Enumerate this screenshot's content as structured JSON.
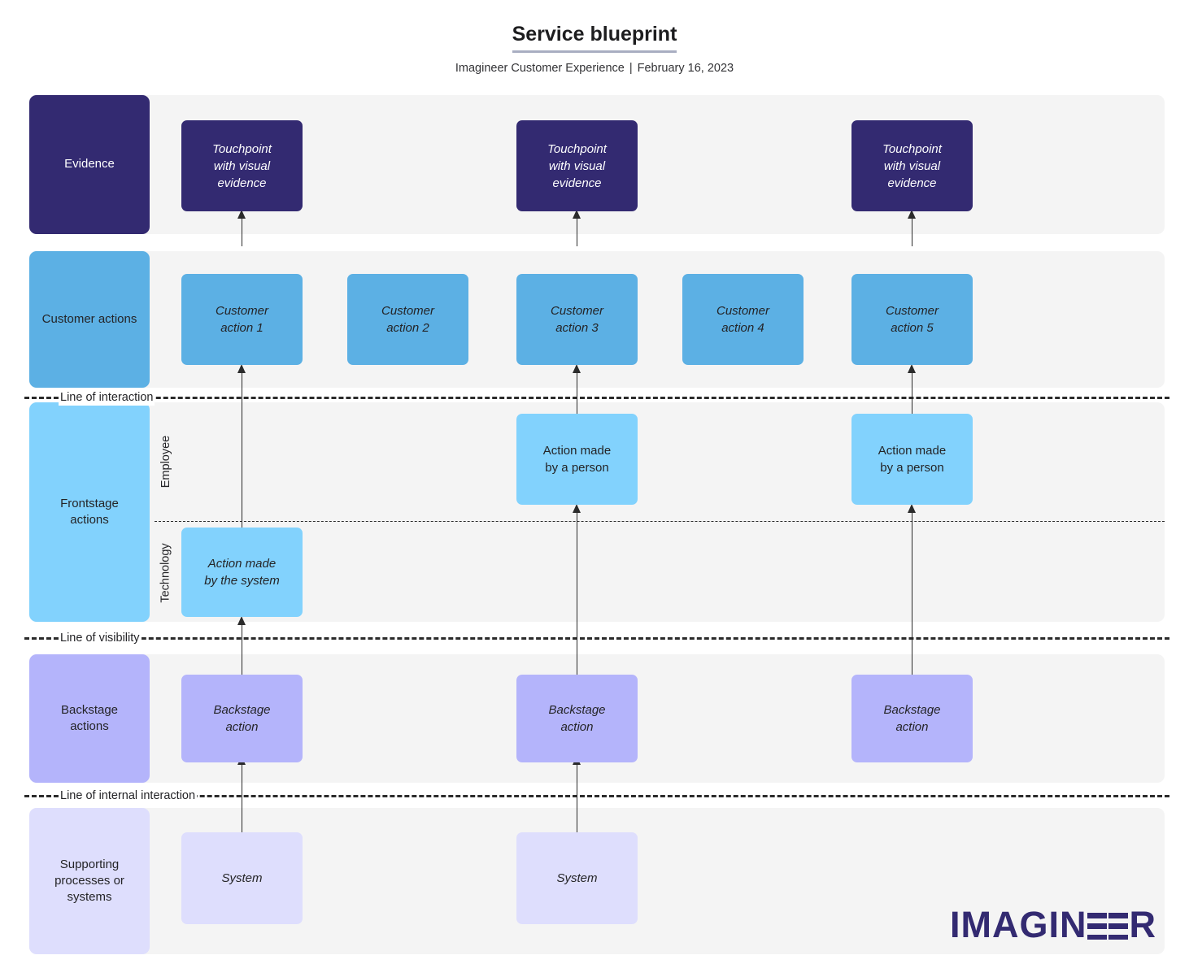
{
  "header": {
    "title": "Service blueprint",
    "org": "Imagineer Customer Experience",
    "separator": "|",
    "date": "February 16, 2023"
  },
  "rows": {
    "evidence": "Evidence",
    "customer_actions": "Customer actions",
    "frontstage_actions": "Frontstage\nactions",
    "frontstage_actions_line1": "Frontstage",
    "frontstage_actions_line2": "actions",
    "backstage_actions_line1": "Backstage",
    "backstage_actions_line2": "actions",
    "support_line1": "Supporting",
    "support_line2": "processes or",
    "support_line3": "systems"
  },
  "sublanes": {
    "employee": "Employee",
    "technology": "Technology"
  },
  "separators": {
    "interaction": "Line of interaction",
    "visibility": "Line of visibility",
    "internal_interaction": "Line of internal interaction"
  },
  "cards": {
    "evidence": [
      {
        "line1": "Touchpoint",
        "line2": "with visual",
        "line3": "evidence",
        "column": 1
      },
      {
        "line1": "Touchpoint",
        "line2": "with visual",
        "line3": "evidence",
        "column": 3
      },
      {
        "line1": "Touchpoint",
        "line2": "with visual",
        "line3": "evidence",
        "column": 5
      }
    ],
    "customer_actions": [
      {
        "line1": "Customer",
        "line2": "action 1",
        "column": 1
      },
      {
        "line1": "Customer",
        "line2": "action 2",
        "column": 2
      },
      {
        "line1": "Customer",
        "line2": "action 3",
        "column": 3
      },
      {
        "line1": "Customer",
        "line2": "action 4",
        "column": 4
      },
      {
        "line1": "Customer",
        "line2": "action 5",
        "column": 5
      }
    ],
    "frontstage_employee": [
      {
        "line1": "Action made",
        "line2": "by a person",
        "column": 3
      },
      {
        "line1": "Action made",
        "line2": "by a person",
        "column": 5
      }
    ],
    "frontstage_technology": [
      {
        "line1": "Action made",
        "line2": "by the system",
        "column": 1
      }
    ],
    "backstage": [
      {
        "line1": "Backstage",
        "line2": "action",
        "column": 1
      },
      {
        "line1": "Backstage",
        "line2": "action",
        "column": 3
      },
      {
        "line1": "Backstage",
        "line2": "action",
        "column": 5
      }
    ],
    "support": [
      {
        "line1": "System",
        "column": 1
      },
      {
        "line1": "System",
        "column": 3
      }
    ]
  },
  "logo": {
    "part1": "IMAGIN",
    "part2": "R",
    "full": "IMAGINEER"
  },
  "colors": {
    "evidence": "#332a71",
    "customer": "#5cb0e4",
    "frontstage": "#82d2fd",
    "backstage": "#b4b4fb",
    "support": "#dedefd",
    "band": "#f4f4f4",
    "line": "#2b2b2b",
    "brand": "#332a71"
  }
}
